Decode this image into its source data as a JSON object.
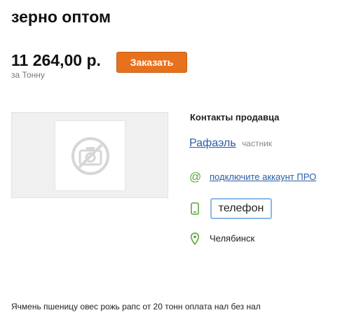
{
  "listing": {
    "title": "зерно оптом",
    "price": "11 264,00 р.",
    "unit": "за Тонну",
    "order_label": "Заказать",
    "description": "Ячмень пшеницу овес рожь рапс от 20 тонн оплата нал без нал"
  },
  "photo": {
    "icon": "no-photo-icon"
  },
  "contacts": {
    "title": "Контакты продавца",
    "seller_name": "Рафаэль",
    "seller_type": "частник",
    "email_icon": "at-icon",
    "pro_link": "подключите аккаунт ПРО",
    "phone_icon": "phone-icon",
    "phone_label": "телефон",
    "location_icon": "pin-icon",
    "city": "Челябинск"
  },
  "colors": {
    "accent": "#e8711e",
    "link": "#2a5da8",
    "icon_green": "#5aa83c",
    "phone_border": "#8ab9e8"
  }
}
